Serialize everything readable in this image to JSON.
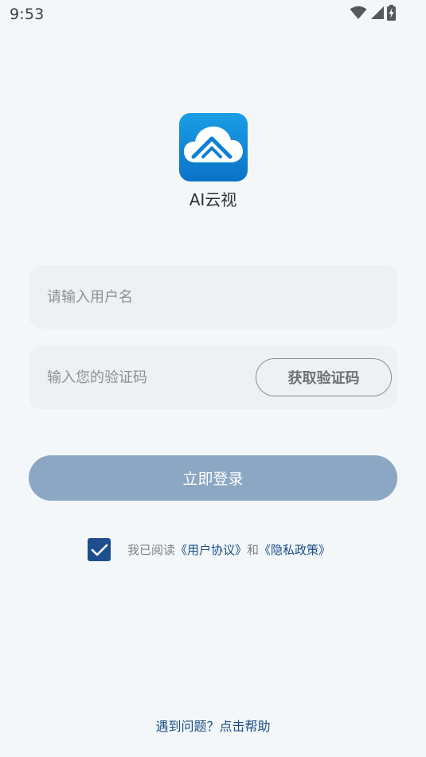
{
  "status_bar": {
    "time": "9:53",
    "icons": [
      "wifi-icon",
      "signal-icon",
      "battery-charging-icon"
    ]
  },
  "app": {
    "name": "AI云视",
    "logo_icon": "cloud-roof-icon",
    "colors": {
      "logo_top": "#1b9ee6",
      "logo_bottom": "#0a72c8"
    }
  },
  "form": {
    "username_placeholder": "请输入用户名",
    "code_placeholder": "输入您的验证码",
    "get_code_label": "获取验证码",
    "login_label": "立即登录",
    "login_color": "#8ba7c4"
  },
  "agreement": {
    "checked": true,
    "prefix": "我已阅读",
    "user_agreement": "《用户协议》",
    "conjunction": "和",
    "privacy_policy": "《隐私政策》",
    "accent_color": "#1c4e86"
  },
  "help_link": "遇到问题？点击帮助"
}
